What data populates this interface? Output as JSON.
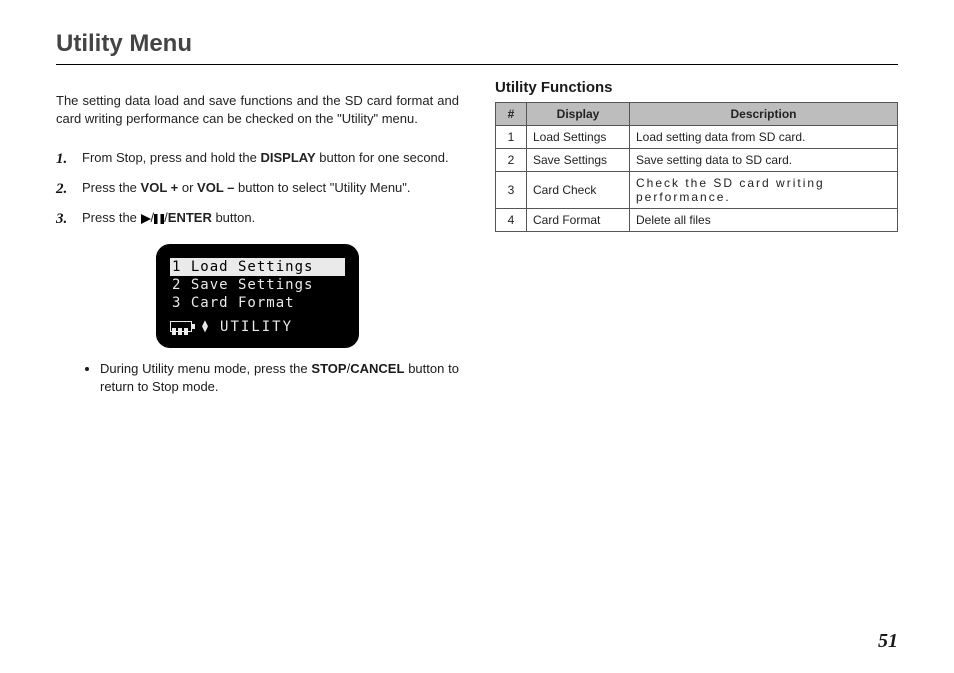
{
  "page_title": "Utility Menu",
  "page_number": "51",
  "intro": "The setting data load and save functions and the SD card format and card writing performance can be checked on the \"Utility\" menu.",
  "steps": {
    "s1_a": "From Stop, press and hold the ",
    "s1_b": "DISPLAY",
    "s1_c": " button for one second.",
    "s2_a": "Press the ",
    "s2_b": "VOL +",
    "s2_c": " or ",
    "s2_d": "VOL –",
    "s2_e": " button to select \"Utility Menu\".",
    "s3_a": "Press the ",
    "s3_b": "ENTER",
    "s3_c": " button."
  },
  "lcd": {
    "line1": "1 Load Settings",
    "line2": "2 Save Settings",
    "line3": "3 Card Format",
    "footer": "UTILITY"
  },
  "note_a": "During Utility menu mode, press the ",
  "note_b": "STOP",
  "note_c": "CANCEL",
  "note_d": " button to return to Stop mode.",
  "right": {
    "heading": "Utility Functions",
    "head_num": "#",
    "head_display": "Display",
    "head_desc": "Description",
    "rows": [
      {
        "n": "1",
        "display": "Load Settings",
        "desc": "Load setting data from SD card."
      },
      {
        "n": "2",
        "display": "Save Settings",
        "desc": "Save setting data to SD card."
      },
      {
        "n": "3",
        "display": "Card Check",
        "desc": "Check the SD card writing performance."
      },
      {
        "n": "4",
        "display": "Card Format",
        "desc": "Delete all files"
      }
    ]
  }
}
